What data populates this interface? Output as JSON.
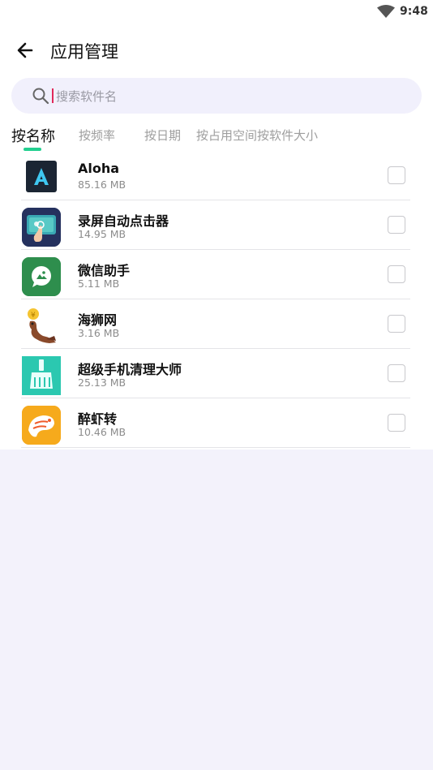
{
  "status_bar": {
    "time": "9:48"
  },
  "header": {
    "title": "应用管理"
  },
  "search": {
    "placeholder": "搜索软件名"
  },
  "sort_tabs": [
    {
      "label": "按名称",
      "active": true
    },
    {
      "label": "按频率",
      "active": false
    },
    {
      "label": "按日期",
      "active": false
    },
    {
      "label": "按占用空间",
      "active": false
    },
    {
      "label": "按软件大小",
      "active": false
    }
  ],
  "apps": [
    {
      "name": "Aloha",
      "size": "85.16 MB",
      "icon": "aloha-icon",
      "checked": false
    },
    {
      "name": "录屏自动点击器",
      "size": "14.95 MB",
      "icon": "auto-clicker-icon",
      "checked": false
    },
    {
      "name": "微信助手",
      "size": "5.11 MB",
      "icon": "wechat-assistant-icon",
      "checked": false
    },
    {
      "name": "海狮网",
      "size": "3.16 MB",
      "icon": "sea-lion-icon",
      "checked": false
    },
    {
      "name": "超级手机清理大师",
      "size": "25.13 MB",
      "icon": "phone-cleaner-icon",
      "checked": false
    },
    {
      "name": "醉虾转",
      "size": "10.46 MB",
      "icon": "shrimp-icon",
      "checked": false
    }
  ],
  "colors": {
    "accent": "#22cf8f",
    "caret": "#e0285a",
    "page_background": "#f3f2fb"
  }
}
